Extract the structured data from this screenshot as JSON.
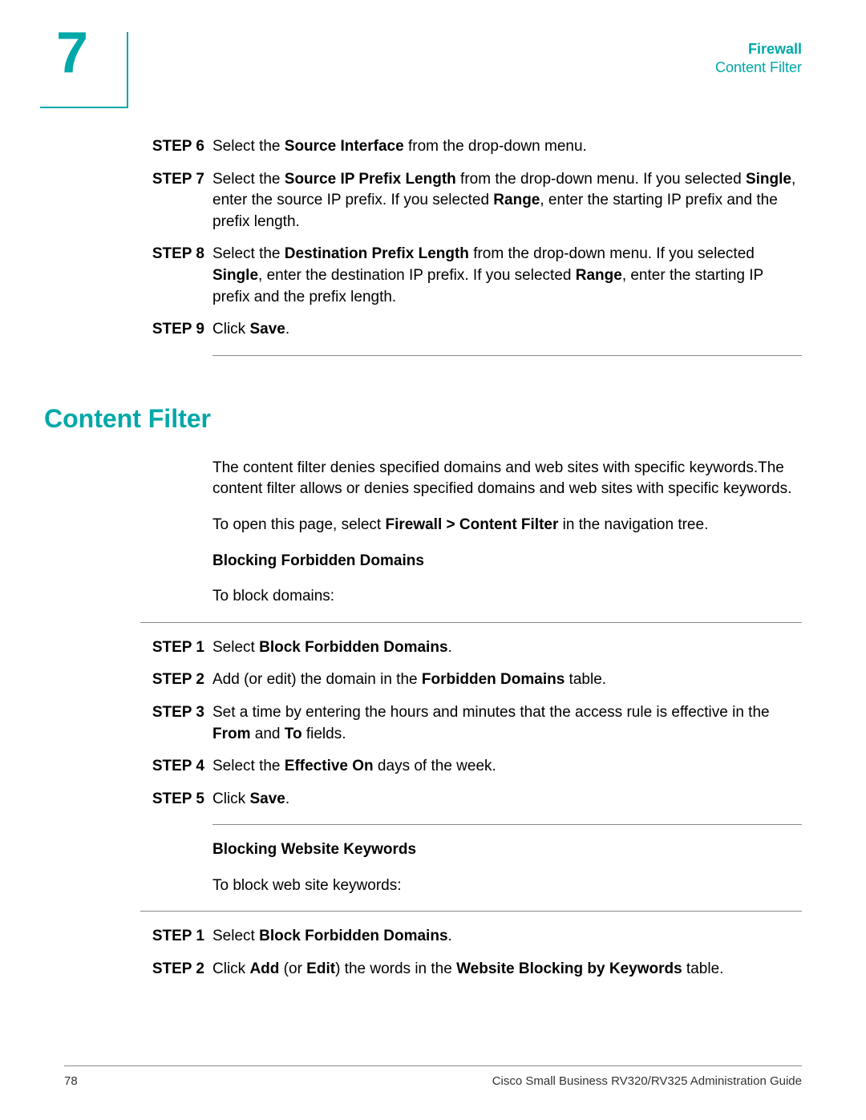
{
  "header": {
    "chapter_num": "7",
    "title": "Firewall",
    "subtitle": "Content Filter"
  },
  "steps_top": [
    {
      "label": "STEP  6",
      "html": "Select the <b>Source Interface</b> from the drop-down menu."
    },
    {
      "label": "STEP  7",
      "html": "Select the <b>Source IP Prefix Length</b> from the drop-down menu. If you selected <b>Single</b>, enter the source IP prefix. If you selected <b>Range</b>, enter the starting IP prefix and the prefix length."
    },
    {
      "label": "STEP  8",
      "html": "Select the <b>Destination Prefix Length</b> from the drop-down menu. If you selected <b>Single</b>, enter the destination IP prefix. If you selected <b>Range</b>, enter the starting IP prefix and the prefix length."
    },
    {
      "label": "STEP  9",
      "html": "Click <b>Save</b>."
    }
  ],
  "section": {
    "title": "Content Filter",
    "intro1": "The content filter denies specified domains and web sites with specific keywords.The content filter allows or denies specified domains and web sites with specific keywords.",
    "intro2_html": "To open this page, select <b>Firewall > Content Filter</b> in the navigation tree.",
    "sub1_title": "Blocking Forbidden Domains",
    "sub1_intro": "To block domains:",
    "sub1_steps": [
      {
        "label": "STEP  1",
        "html": "Select <b>Block Forbidden Domains</b>."
      },
      {
        "label": "STEP  2",
        "html": "Add (or edit) the domain in the <b>Forbidden Domains</b> table."
      },
      {
        "label": "STEP  3",
        "html": "Set a time by entering the hours and minutes that the access rule is effective in the <b>From</b> and <b>To</b> fields."
      },
      {
        "label": "STEP  4",
        "html": "Select the <b>Effective On</b> days of the week."
      },
      {
        "label": "STEP  5",
        "html": "Click <b>Save</b>."
      }
    ],
    "sub2_title": "Blocking Website Keywords",
    "sub2_intro": "To block web site keywords:",
    "sub2_steps": [
      {
        "label": "STEP  1",
        "html": "Select <b>Block Forbidden Domains</b>."
      },
      {
        "label": "STEP  2",
        "html": "Click <b>Add</b> (or <b>Edit</b>) the words in the <b>Website Blocking by Keywords</b> table."
      }
    ]
  },
  "footer": {
    "page": "78",
    "doc": "Cisco Small Business RV320/RV325 Administration Guide"
  }
}
